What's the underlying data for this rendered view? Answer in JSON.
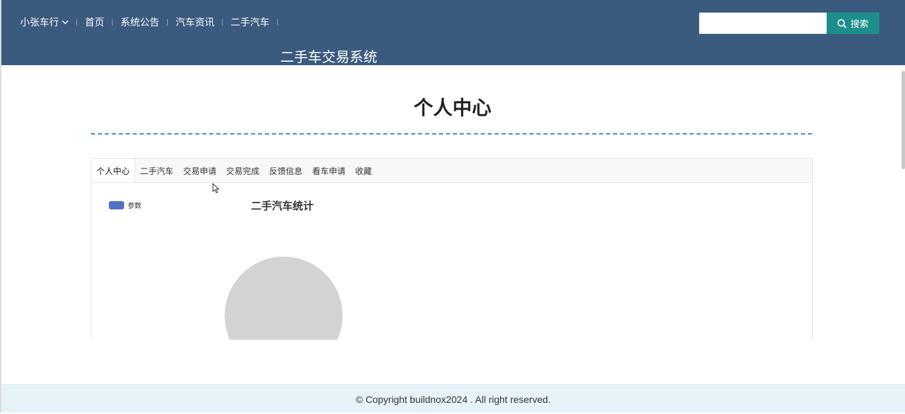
{
  "header": {
    "brand_label": "小张车行",
    "nav_items": [
      "首页",
      "系统公告",
      "汽车资讯",
      "二手汽车"
    ],
    "site_title": "二手车交易系统",
    "search": {
      "value": "",
      "placeholder": "",
      "button_label": "搜索"
    },
    "background_color": "#3a5a7e",
    "search_button_color": "#1d8f8a"
  },
  "main": {
    "page_title": "个人中心",
    "tabs": [
      {
        "label": "个人中心",
        "active": true
      },
      {
        "label": "二手汽车",
        "active": false
      },
      {
        "label": "交易申请",
        "active": false
      },
      {
        "label": "交易完成",
        "active": false
      },
      {
        "label": "反馈信息",
        "active": false
      },
      {
        "label": "看车申请",
        "active": false
      },
      {
        "label": "收藏",
        "active": false
      }
    ]
  },
  "chart_data": {
    "type": "pie",
    "title": "二手汽车统计",
    "legend": {
      "entries": [
        "参数"
      ],
      "position": "top-left"
    },
    "series": [
      {
        "name": "参数",
        "values": []
      }
    ],
    "colors": {
      "legend": "#5470c6",
      "empty_pie": "#d3d3d3"
    }
  },
  "footer": {
    "copyright": "© Copyright buildnox2024 . All right reserved."
  }
}
